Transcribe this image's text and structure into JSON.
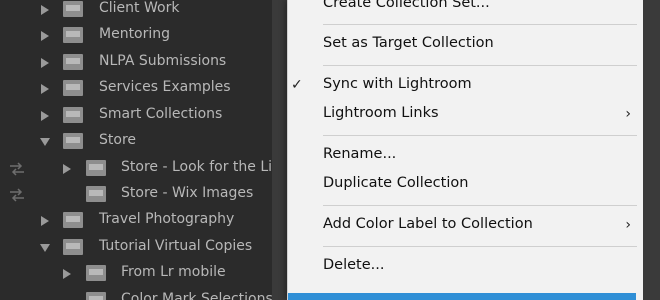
{
  "collections": [
    {
      "label": "Client Work",
      "indent": 0,
      "expander": "right",
      "sync": false
    },
    {
      "label": "Mentoring",
      "indent": 0,
      "expander": "right",
      "sync": false
    },
    {
      "label": "NLPA Submissions",
      "indent": 0,
      "expander": "right",
      "sync": false
    },
    {
      "label": "Services Examples",
      "indent": 0,
      "expander": "right",
      "sync": false
    },
    {
      "label": "Smart Collections",
      "indent": 0,
      "expander": "right",
      "sync": false
    },
    {
      "label": "Store",
      "indent": 0,
      "expander": "down",
      "sync": false
    },
    {
      "label": "Store - Look for the Lig",
      "indent": 1,
      "expander": "right",
      "sync": true
    },
    {
      "label": "Store - Wix Images",
      "indent": 1,
      "expander": "none",
      "sync": true
    },
    {
      "label": "Travel Photography",
      "indent": 0,
      "expander": "right",
      "sync": false
    },
    {
      "label": "Tutorial Virtual Copies",
      "indent": 0,
      "expander": "down",
      "sync": false
    },
    {
      "label": "From Lr mobile",
      "indent": 1,
      "expander": "right",
      "sync": false
    },
    {
      "label": "Color Mark Selections",
      "indent": 1,
      "expander": "none",
      "sync": false
    }
  ],
  "menu": {
    "create_collection_set": "Create Collection Set...",
    "set_target": "Set as Target Collection",
    "sync": "Sync with Lightroom",
    "sync_check": "✓",
    "links": "Lightroom Links",
    "links_arrow": "›",
    "rename": "Rename...",
    "duplicate": "Duplicate Collection",
    "color_label": "Add Color Label to Collection",
    "color_arrow": "›",
    "delete": "Delete..."
  },
  "colors": {
    "panel_bg": "#2b2b2b",
    "menu_bg": "#f2f2f2",
    "highlight": "#2f8fd6"
  },
  "icons": {
    "sync": "sync-arrows-icon",
    "folder": "collection-folder-icon",
    "expand": "triangle-icon"
  }
}
